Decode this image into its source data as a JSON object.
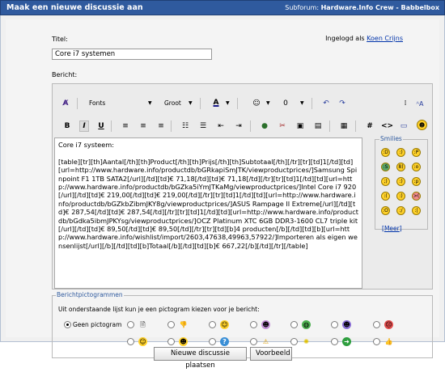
{
  "header": {
    "title": "Maak een nieuwe discussie aan",
    "subforum_label": "Subforum:",
    "subforum_name": "Hardware.Info Crew - Babbelbox"
  },
  "form": {
    "title_label": "Titel:",
    "logged_in_prefix": "Ingelogd als",
    "logged_in_user": "Koen Crijns",
    "title_value": "Core i7 systemen",
    "message_label": "Bericht:"
  },
  "toolbar": {
    "font_label": "Fonts",
    "size_label": "Groot"
  },
  "message_text": "Core i7 systeem:\n\n[table][tr][th]Aantal[/th][th]Product[/th][th]Prijs[/th][th]Subtotaal[/th][/tr][tr][td]1[/td][td][url=http://www.hardware.info/productdb/bGRkapiSmJTK/viewproductprices/]Samsung Spinpoint F1 1TB SATA2[/url][/td][td]€ 71,18[/td][td]€ 71,18[/td][/tr][tr][td]1[/td][td][url=http://www.hardware.info/productdb/bGZka5iYmJTKaMg/viewproductprices/]Intel Core i7 920[/url][/td][td]€ 219,00[/td][td]€ 219,00[/td][/tr][tr][td]1[/td][td][url=http://www.hardware.info/productdb/bGZkbZibmJKY8g/viewproductprices/]ASUS Rampage II Extreme[/url][/td][td]€ 287,54[/td][td]€ 287,54[/td][/tr][tr][td]1[/td][td][url=http://www.hardware.info/productdb/bGdka5ibmJPKYsg/viewproductprices/]OCZ Platinum XTC 6GB DDR3-1600 CL7 triple kit[/url][/td][td]€ 89,50[/td][td]€ 89,50[/td][/tr][tr][td][b]4 producten[/b][/td][td][b][url=http://www.hardware.info/wishlist/import/2603,47638,49963,57922/]Importeren als eigen wensenlijst[/url][/b][/td][td][b]Totaal[/b][/td][td][b]€ 667,22[/b][/td][/tr][/table]",
  "smilies": {
    "legend": "Smilies",
    "more_link": "Meer"
  },
  "pictograms": {
    "legend": "Berichtpictogrammen",
    "hint": "Uit onderstaande lijst kun je een pictogram kiezen voor je bericht:",
    "none_label": "Geen pictogram"
  },
  "buttons": {
    "submit": "Nieuwe discussie plaatsen",
    "preview": "Voorbeeld"
  }
}
